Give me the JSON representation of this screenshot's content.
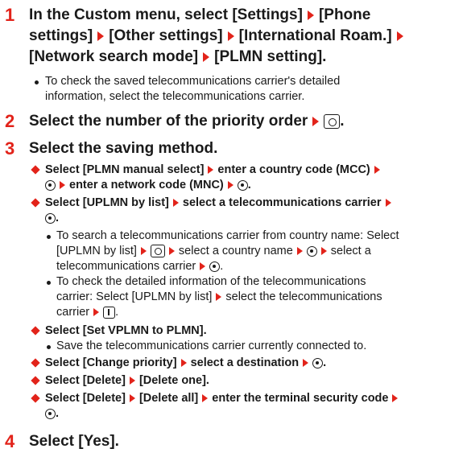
{
  "steps": [
    {
      "num": "1",
      "title_lines": [
        "In the Custom menu, select [Settings]",
        "[Phone",
        "settings]",
        "[Other settings]",
        "[International Roam.]",
        "[Network search mode]",
        "[PLMN setting]."
      ],
      "bullets": [
        [
          "To check the saved telecommunications carrier's detailed",
          "information, select the telecommunications carrier."
        ]
      ]
    },
    {
      "num": "2",
      "title_parts": [
        "Select the number of the priority order",
        "."
      ]
    },
    {
      "num": "3",
      "title": "Select the saving method.",
      "options": [
        {
          "parts": [
            "Select [PLMN manual select]",
            "enter a country code (MCC)",
            "enter a network code (MNC)",
            "."
          ]
        },
        {
          "parts": [
            "Select [UPLMN by list]",
            "select a telecommunications carrier",
            "."
          ],
          "sub": [
            {
              "lines": [
                "To search a telecommunications carrier from country name: Select",
                "[UPLMN by list]",
                "select a country name",
                "select a",
                "telecommunications carrier",
                "."
              ]
            },
            {
              "lines": [
                "To check the detailed information of the telecommunications",
                "carrier: Select [UPLMN by list]",
                "select the telecommunications",
                "carrier",
                "."
              ]
            }
          ]
        },
        {
          "parts": [
            "Select [Set VPLMN to PLMN]."
          ],
          "sub": [
            {
              "lines": [
                "Save the telecommunications carrier currently connected to."
              ]
            }
          ]
        },
        {
          "parts": [
            "Select [Change priority]",
            "select a destination",
            "."
          ]
        },
        {
          "parts": [
            "Select [Delete]",
            "[Delete one]."
          ]
        },
        {
          "parts": [
            "Select [Delete]",
            "[Delete all]",
            "enter the terminal security code",
            "."
          ]
        }
      ]
    },
    {
      "num": "4",
      "title": "Select [Yes]."
    }
  ],
  "colors": {
    "accent": "#e2231a",
    "text": "#1a1a1a"
  },
  "icons": {
    "arrow": "right-triangle-icon",
    "camera": "camera-key-icon",
    "center": "center-key-icon",
    "info": "info-key-icon"
  }
}
